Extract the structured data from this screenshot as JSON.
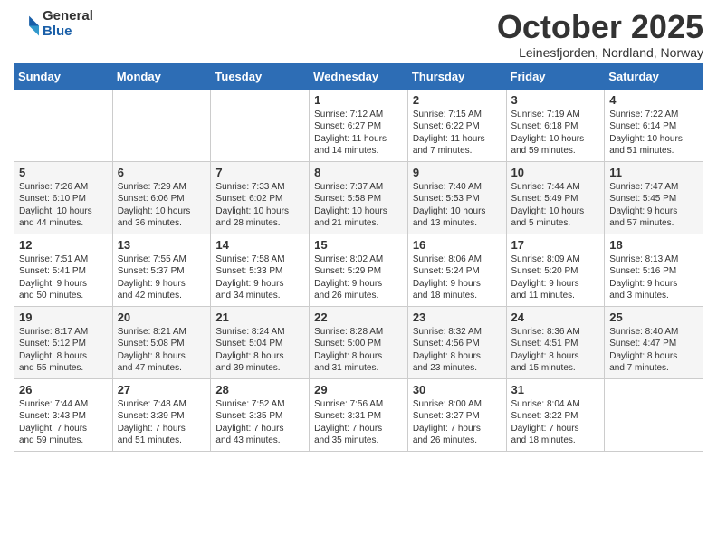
{
  "header": {
    "logo_general": "General",
    "logo_blue": "Blue",
    "month_title": "October 2025",
    "subtitle": "Leinesfjorden, Nordland, Norway"
  },
  "weekdays": [
    "Sunday",
    "Monday",
    "Tuesday",
    "Wednesday",
    "Thursday",
    "Friday",
    "Saturday"
  ],
  "weeks": [
    [
      {
        "day": "",
        "info": ""
      },
      {
        "day": "",
        "info": ""
      },
      {
        "day": "",
        "info": ""
      },
      {
        "day": "1",
        "info": "Sunrise: 7:12 AM\nSunset: 6:27 PM\nDaylight: 11 hours\nand 14 minutes."
      },
      {
        "day": "2",
        "info": "Sunrise: 7:15 AM\nSunset: 6:22 PM\nDaylight: 11 hours\nand 7 minutes."
      },
      {
        "day": "3",
        "info": "Sunrise: 7:19 AM\nSunset: 6:18 PM\nDaylight: 10 hours\nand 59 minutes."
      },
      {
        "day": "4",
        "info": "Sunrise: 7:22 AM\nSunset: 6:14 PM\nDaylight: 10 hours\nand 51 minutes."
      }
    ],
    [
      {
        "day": "5",
        "info": "Sunrise: 7:26 AM\nSunset: 6:10 PM\nDaylight: 10 hours\nand 44 minutes."
      },
      {
        "day": "6",
        "info": "Sunrise: 7:29 AM\nSunset: 6:06 PM\nDaylight: 10 hours\nand 36 minutes."
      },
      {
        "day": "7",
        "info": "Sunrise: 7:33 AM\nSunset: 6:02 PM\nDaylight: 10 hours\nand 28 minutes."
      },
      {
        "day": "8",
        "info": "Sunrise: 7:37 AM\nSunset: 5:58 PM\nDaylight: 10 hours\nand 21 minutes."
      },
      {
        "day": "9",
        "info": "Sunrise: 7:40 AM\nSunset: 5:53 PM\nDaylight: 10 hours\nand 13 minutes."
      },
      {
        "day": "10",
        "info": "Sunrise: 7:44 AM\nSunset: 5:49 PM\nDaylight: 10 hours\nand 5 minutes."
      },
      {
        "day": "11",
        "info": "Sunrise: 7:47 AM\nSunset: 5:45 PM\nDaylight: 9 hours\nand 57 minutes."
      }
    ],
    [
      {
        "day": "12",
        "info": "Sunrise: 7:51 AM\nSunset: 5:41 PM\nDaylight: 9 hours\nand 50 minutes."
      },
      {
        "day": "13",
        "info": "Sunrise: 7:55 AM\nSunset: 5:37 PM\nDaylight: 9 hours\nand 42 minutes."
      },
      {
        "day": "14",
        "info": "Sunrise: 7:58 AM\nSunset: 5:33 PM\nDaylight: 9 hours\nand 34 minutes."
      },
      {
        "day": "15",
        "info": "Sunrise: 8:02 AM\nSunset: 5:29 PM\nDaylight: 9 hours\nand 26 minutes."
      },
      {
        "day": "16",
        "info": "Sunrise: 8:06 AM\nSunset: 5:24 PM\nDaylight: 9 hours\nand 18 minutes."
      },
      {
        "day": "17",
        "info": "Sunrise: 8:09 AM\nSunset: 5:20 PM\nDaylight: 9 hours\nand 11 minutes."
      },
      {
        "day": "18",
        "info": "Sunrise: 8:13 AM\nSunset: 5:16 PM\nDaylight: 9 hours\nand 3 minutes."
      }
    ],
    [
      {
        "day": "19",
        "info": "Sunrise: 8:17 AM\nSunset: 5:12 PM\nDaylight: 8 hours\nand 55 minutes."
      },
      {
        "day": "20",
        "info": "Sunrise: 8:21 AM\nSunset: 5:08 PM\nDaylight: 8 hours\nand 47 minutes."
      },
      {
        "day": "21",
        "info": "Sunrise: 8:24 AM\nSunset: 5:04 PM\nDaylight: 8 hours\nand 39 minutes."
      },
      {
        "day": "22",
        "info": "Sunrise: 8:28 AM\nSunset: 5:00 PM\nDaylight: 8 hours\nand 31 minutes."
      },
      {
        "day": "23",
        "info": "Sunrise: 8:32 AM\nSunset: 4:56 PM\nDaylight: 8 hours\nand 23 minutes."
      },
      {
        "day": "24",
        "info": "Sunrise: 8:36 AM\nSunset: 4:51 PM\nDaylight: 8 hours\nand 15 minutes."
      },
      {
        "day": "25",
        "info": "Sunrise: 8:40 AM\nSunset: 4:47 PM\nDaylight: 8 hours\nand 7 minutes."
      }
    ],
    [
      {
        "day": "26",
        "info": "Sunrise: 7:44 AM\nSunset: 3:43 PM\nDaylight: 7 hours\nand 59 minutes."
      },
      {
        "day": "27",
        "info": "Sunrise: 7:48 AM\nSunset: 3:39 PM\nDaylight: 7 hours\nand 51 minutes."
      },
      {
        "day": "28",
        "info": "Sunrise: 7:52 AM\nSunset: 3:35 PM\nDaylight: 7 hours\nand 43 minutes."
      },
      {
        "day": "29",
        "info": "Sunrise: 7:56 AM\nSunset: 3:31 PM\nDaylight: 7 hours\nand 35 minutes."
      },
      {
        "day": "30",
        "info": "Sunrise: 8:00 AM\nSunset: 3:27 PM\nDaylight: 7 hours\nand 26 minutes."
      },
      {
        "day": "31",
        "info": "Sunrise: 8:04 AM\nSunset: 3:22 PM\nDaylight: 7 hours\nand 18 minutes."
      },
      {
        "day": "",
        "info": ""
      }
    ]
  ]
}
